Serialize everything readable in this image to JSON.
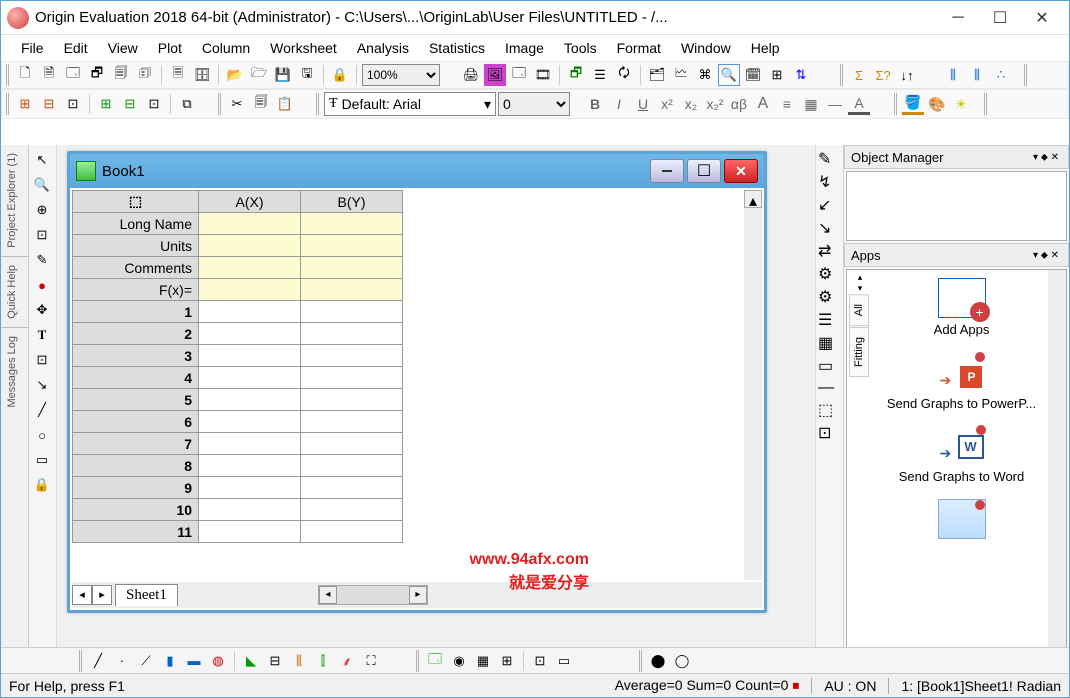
{
  "titlebar": {
    "title": "Origin Evaluation 2018 64-bit (Administrator) - C:\\Users\\...\\OriginLab\\User Files\\UNTITLED - /..."
  },
  "menu": {
    "items": [
      "File",
      "Edit",
      "View",
      "Plot",
      "Column",
      "Worksheet",
      "Analysis",
      "Statistics",
      "Image",
      "Tools",
      "Format",
      "Window",
      "Help"
    ]
  },
  "toolbar1": {
    "zoom": "100%"
  },
  "toolbar2": {
    "font_label": "Default: Arial",
    "font_size": "0",
    "bold": "B",
    "italic": "I",
    "underline": "U",
    "sup": "x²",
    "sub": "x₂",
    "subsup": "x₂²",
    "greek": "αβ",
    "big": "A",
    "align": "≡",
    "color": "A"
  },
  "left_sidebar": {
    "tab1": "Project Explorer (1)",
    "tab2": "Quick Help",
    "tab3": "Messages Log"
  },
  "mdi": {
    "book_title": "Book1",
    "col_a": "A(X)",
    "col_b": "B(Y)",
    "row_headers": [
      "Long Name",
      "Units",
      "Comments",
      "F(x)="
    ],
    "num_rows": [
      "1",
      "2",
      "3",
      "4",
      "5",
      "6",
      "7",
      "8",
      "9",
      "10",
      "11"
    ],
    "sheet": "Sheet1"
  },
  "right": {
    "om_title": "Object Manager",
    "apps_title": "Apps",
    "vtabs": [
      "All",
      "Fitting"
    ],
    "apps": [
      {
        "label": "Add Apps"
      },
      {
        "label": "Send Graphs to PowerP..."
      },
      {
        "label": "Send Graphs to Word"
      }
    ]
  },
  "watermark": {
    "l1": "www.94afx.com",
    "l2": "就是爱分享"
  },
  "status": {
    "help": "For Help, press F1",
    "stats": "Average=0 Sum=0 Count=0",
    "au": "AU : ON",
    "loc": "1: [Book1]Sheet1! Radian"
  }
}
